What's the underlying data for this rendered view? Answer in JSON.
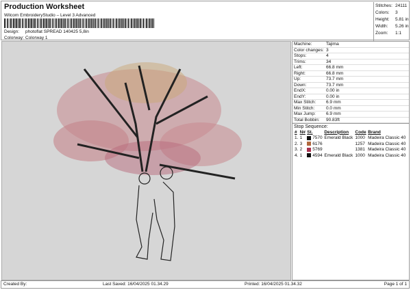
{
  "header": {
    "title": "Production Worksheet",
    "subtitle": "Wilcom EmbroideryStudio – Level 3 Advanced",
    "design_label": "Design:",
    "design_value": "photoflat SPREAD 140425 5,8in",
    "colorway_label": "Colorway:",
    "colorway_value": "Colorway 1"
  },
  "stats": [
    {
      "label": "Stitches:",
      "value": "24111"
    },
    {
      "label": "Colors:",
      "value": "3"
    },
    {
      "label": "Height:",
      "value": "5.81 in"
    },
    {
      "label": "Width:",
      "value": "5.26 in"
    },
    {
      "label": "Zoom:",
      "value": "1:1"
    }
  ],
  "properties": [
    {
      "label": "Machine:",
      "value": "Tajima"
    },
    {
      "label": "Color changes:",
      "value": "3"
    },
    {
      "label": "Stops:",
      "value": "4"
    },
    {
      "label": "Trims:",
      "value": "34"
    },
    {
      "label": "Left:",
      "value": "66.8 mm"
    },
    {
      "label": "Right:",
      "value": "66.8 mm"
    },
    {
      "label": "Up:",
      "value": "73.7 mm"
    },
    {
      "label": "Down:",
      "value": "73.7 mm"
    },
    {
      "label": "EndX:",
      "value": "0.00 in"
    },
    {
      "label": "EndY:",
      "value": "0.00 in"
    },
    {
      "label": "Max Stitch:",
      "value": "6.9 mm"
    },
    {
      "label": "Min Stitch:",
      "value": "0.0 mm"
    },
    {
      "label": "Max Jump:",
      "value": "6.9 mm"
    },
    {
      "label": "Total Bobbin:",
      "value": "90.83ft"
    }
  ],
  "stop_sequence": {
    "title": "Stop Sequence:",
    "headers": [
      "#",
      "N#",
      "St.",
      "Description",
      "Code",
      "Brand"
    ],
    "rows": [
      {
        "n": "1.",
        "needle": "1",
        "color": "#111111",
        "st": "7570",
        "desc": "Emerald Black",
        "code": "1000",
        "brand": "Madeira Classic 40"
      },
      {
        "n": "2.",
        "needle": "3",
        "color": "#b0683e",
        "st": "6176",
        "desc": "",
        "code": "1257",
        "brand": "Madeira Classic 40"
      },
      {
        "n": "3.",
        "needle": "2",
        "color": "#a8304e",
        "st": "5769",
        "desc": "",
        "code": "1381",
        "brand": "Madeira Classic 40"
      },
      {
        "n": "4.",
        "needle": "1",
        "color": "#111111",
        "st": "4594",
        "desc": "Emerald Black",
        "code": "1000",
        "brand": "Madeira Classic 40"
      }
    ]
  },
  "footer": {
    "created": "Created By:",
    "saved": "Last Saved: 16/04/2025 01.34.29",
    "printed": "Printed: 16/04/2025 01.34.32",
    "page": "Page 1 of 1"
  }
}
